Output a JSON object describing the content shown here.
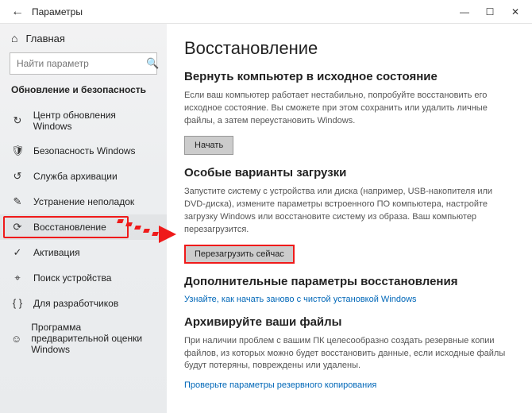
{
  "titlebar": {
    "title": "Параметры"
  },
  "sidebar": {
    "home": "Главная",
    "search_placeholder": "Найти параметр",
    "category": "Обновление и безопасность",
    "items": [
      {
        "label": "Центр обновления Windows",
        "icon": "↻"
      },
      {
        "label": "Безопасность Windows",
        "icon": "🛡"
      },
      {
        "label": "Служба архивации",
        "icon": "↺"
      },
      {
        "label": "Устранение неполадок",
        "icon": "✎"
      },
      {
        "label": "Восстановление",
        "icon": "⟳"
      },
      {
        "label": "Активация",
        "icon": "✓"
      },
      {
        "label": "Поиск устройства",
        "icon": "⌖"
      },
      {
        "label": "Для разработчиков",
        "icon": "{ }"
      },
      {
        "label": "Программа предварительной оценки Windows",
        "icon": "☺"
      }
    ]
  },
  "main": {
    "title": "Восстановление",
    "section1": {
      "heading": "Вернуть компьютер в исходное состояние",
      "desc": "Если ваш компьютер работает нестабильно, попробуйте восстановить его исходное состояние. Вы сможете при этом сохранить или удалить личные файлы, а затем переустановить Windows.",
      "button": "Начать"
    },
    "section2": {
      "heading": "Особые варианты загрузки",
      "desc": "Запустите систему с устройства или диска (например, USB-накопителя или DVD-диска), измените параметры встроенного ПО компьютера, настройте загрузку Windows или восстановите систему из образа. Ваш компьютер перезагрузится.",
      "button": "Перезагрузить сейчас"
    },
    "section3": {
      "heading": "Дополнительные параметры восстановления",
      "link": "Узнайте, как начать заново с чистой установкой Windows"
    },
    "section4": {
      "heading": "Архивируйте ваши файлы",
      "desc": "При наличии проблем с вашим ПК целесообразно создать резервные копии файлов, из которых можно будет восстановить данные, если исходные файлы будут потеряны, повреждены или удалены.",
      "link": "Проверьте параметры резервного копирования"
    }
  }
}
